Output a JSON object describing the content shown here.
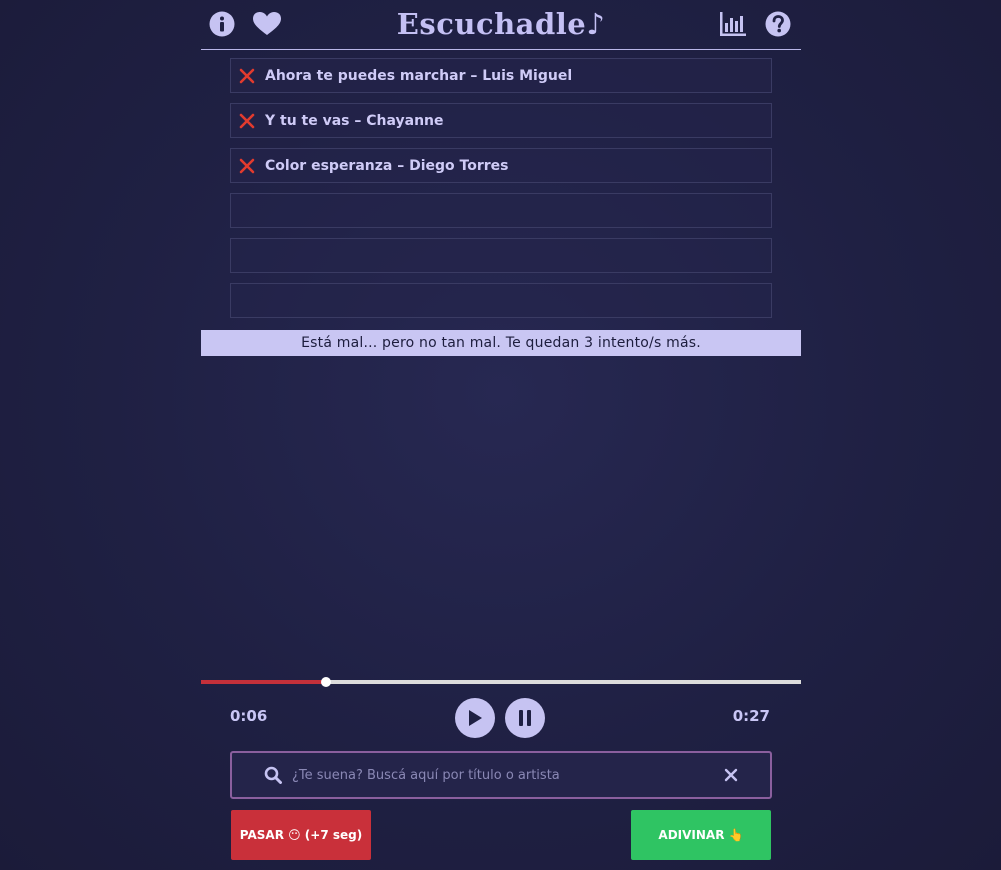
{
  "app": {
    "title": "Escuchadle♪"
  },
  "header": {
    "icons": [
      "info-icon",
      "heart-icon",
      "stats-icon",
      "help-icon"
    ]
  },
  "guesses": [
    {
      "text": "Ahora te puedes marchar – Luis Miguel",
      "status": "wrong"
    },
    {
      "text": "Y tu te vas – Chayanne",
      "status": "wrong"
    },
    {
      "text": "Color esperanza – Diego Torres",
      "status": "wrong"
    },
    {
      "text": "",
      "status": "empty"
    },
    {
      "text": "",
      "status": "empty"
    },
    {
      "text": "",
      "status": "empty"
    }
  ],
  "message": "Está mal... pero no tan mal. Te quedan 3 intento/s más.",
  "player": {
    "current_time": "0:06",
    "total_time": "0:27",
    "progress": 0.208
  },
  "search": {
    "placeholder": "¿Te suena? Buscá aquí por título o artista",
    "value": ""
  },
  "buttons": {
    "skip_label": "PASAR 😶 (+7 seg)",
    "guess_label": "ADIVINAR 👆"
  },
  "colors": {
    "background": "#1f2043",
    "accent": "#c6c3f2",
    "wrong": "#e23b2e",
    "skip": "#c9303a",
    "guess": "#2fc463",
    "progress": "#c4303a"
  }
}
